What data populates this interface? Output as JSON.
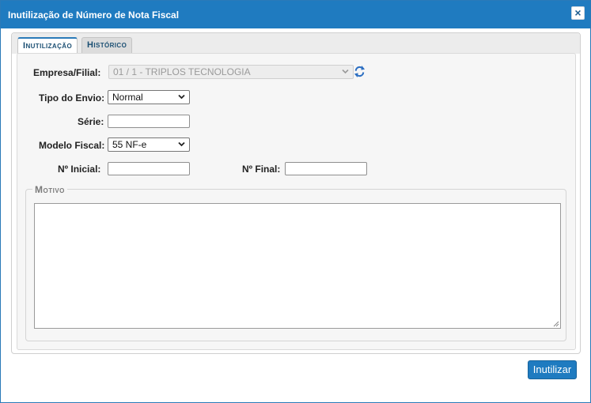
{
  "dialog": {
    "title": "Inutilização de Número de Nota Fiscal",
    "close_symbol": "×"
  },
  "tabs": [
    {
      "label": "Inutilização",
      "active": true
    },
    {
      "label": "Histórico",
      "active": false
    }
  ],
  "form": {
    "empresa": {
      "label": "Empresa/Filial:",
      "value": "01 / 1 - TRIPLOS TECNOLOGIA",
      "disabled": true
    },
    "tipo_envio": {
      "label": "Tipo do Envio:",
      "value": "Normal"
    },
    "serie": {
      "label": "Série:",
      "value": ""
    },
    "modelo": {
      "label": "Modelo Fiscal:",
      "value": "55 NF-e"
    },
    "numero_inicial": {
      "label": "Nº Inicial:",
      "value": ""
    },
    "numero_final": {
      "label": "Nº Final:",
      "value": ""
    },
    "motivo": {
      "legend": "Motivo",
      "value": ""
    }
  },
  "actions": {
    "submit_label": "Inutilizar"
  },
  "icons": {
    "refresh": "refresh-icon",
    "dropdown": "chevron-down-icon",
    "close": "close-icon"
  },
  "colors": {
    "accent": "#1f7bc0",
    "title_text": "#ffffff"
  }
}
